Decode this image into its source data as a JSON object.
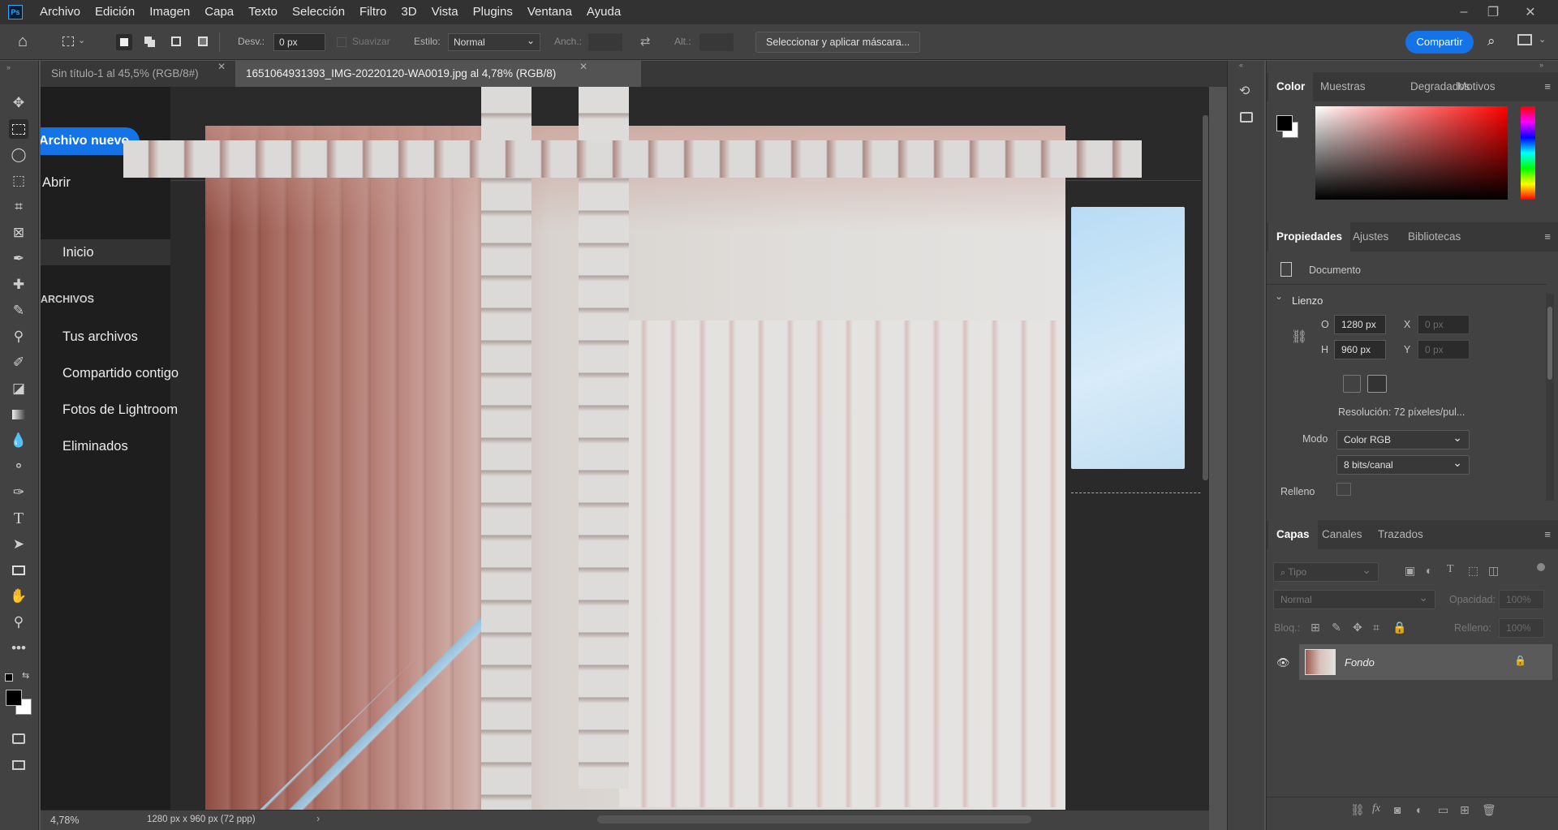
{
  "menu": {
    "app_logo": "Ps",
    "items": [
      "Archivo",
      "Edición",
      "Imagen",
      "Capa",
      "Texto",
      "Selección",
      "Filtro",
      "3D",
      "Vista",
      "Plugins",
      "Ventana",
      "Ayuda"
    ]
  },
  "options": {
    "desv_label": "Desv.:",
    "desv_value": "0 px",
    "suavizar_label": "Suavizar",
    "estilo_label": "Estilo:",
    "estilo_value": "Normal",
    "anch_label": "Anch.:",
    "alt_label": "Alt.:",
    "mask_button": "Seleccionar y aplicar máscara...",
    "share_button": "Compartir"
  },
  "tabs": [
    {
      "label": "Sin título-1 al 45,5% (RGB/8#)",
      "active": false
    },
    {
      "label": "1651064931393_IMG-20220120-WA0019.jpg al 4,78% (RGB/8)",
      "active": true
    }
  ],
  "home_overlay": {
    "new_file": "Archivo nuevo",
    "open": "Abrir",
    "home": "Inicio",
    "section": "ARCHIVOS",
    "items": [
      "Tus archivos",
      "Compartido contigo",
      "Fotos de Lightroom",
      "Eliminados"
    ]
  },
  "status": {
    "zoom": "4,78%",
    "doc_info": "1280 px x 960 px (72 ppp)"
  },
  "color_panel": {
    "tabs": [
      "Color",
      "Muestras",
      "Degradados",
      "Motivos"
    ],
    "foreground": "#000000",
    "background": "#ffffff",
    "hue_color": "#ff0000"
  },
  "properties_panel": {
    "tabs": [
      "Propiedades",
      "Ajustes",
      "Bibliotecas"
    ],
    "doc_label": "Documento",
    "section": "Lienzo",
    "w_label": "O",
    "w_value": "1280 px",
    "h_label": "H",
    "h_value": "960 px",
    "x_label": "X",
    "x_placeholder": "0 px",
    "y_label": "Y",
    "y_placeholder": "0 px",
    "resolution": "Resolución: 72 píxeles/pul...",
    "mode_label": "Modo",
    "mode_value": "Color RGB",
    "bits_value": "8 bits/canal",
    "fill_label": "Relleno"
  },
  "layers_panel": {
    "tabs": [
      "Capas",
      "Canales",
      "Trazados"
    ],
    "filter_placeholder": "Tipo",
    "blend_mode": "Normal",
    "opacity_label": "Opacidad:",
    "opacity_value": "100%",
    "lock_label": "Bloq.:",
    "fill_label": "Relleno:",
    "fill_value": "100%",
    "layers": [
      {
        "name": "Fondo",
        "visible": true,
        "locked": true
      }
    ]
  }
}
